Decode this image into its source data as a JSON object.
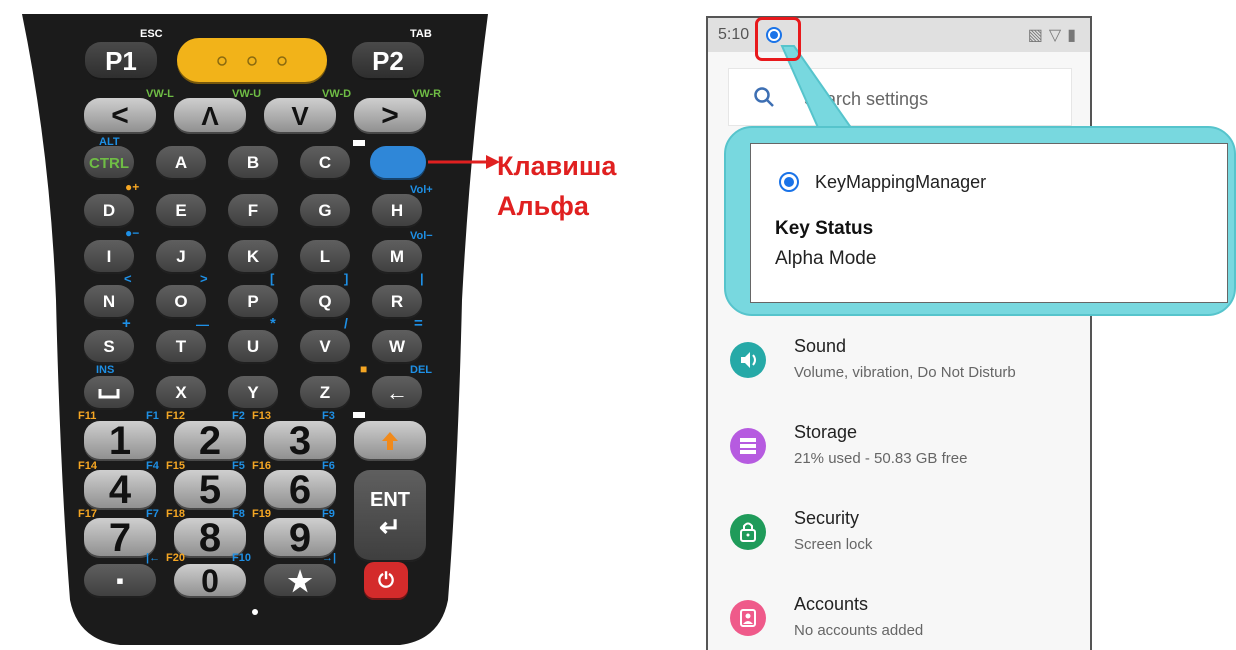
{
  "keypad": {
    "function_labels": {
      "esc": "ESC",
      "tab": "TAB",
      "alt": "ALT",
      "ins": "INS",
      "del": "DEL"
    },
    "top_keys": {
      "p1": "P1",
      "p2": "P2"
    },
    "nav_labels": {
      "vw_l": "VW-L",
      "vw_u": "VW-U",
      "vw_d": "VW-D",
      "vw_r": "VW-R"
    },
    "nav_keys": {
      "left": "<",
      "up": "Λ",
      "down": "V",
      "right": ">"
    },
    "volume_labels": {
      "up": "Vol+",
      "down": "Vol−"
    },
    "letter_keys": [
      "CTRL",
      "A",
      "B",
      "C",
      "D",
      "E",
      "F",
      "G",
      "H",
      "I",
      "J",
      "K",
      "L",
      "M",
      "N",
      "O",
      "P",
      "Q",
      "R",
      "S",
      "T",
      "U",
      "V",
      "W",
      "X",
      "Y",
      "Z"
    ],
    "symbol_labels": {
      "lt": "<",
      "gt": ">",
      "lbrack": "[",
      "rbrack": "]",
      "pipe": "|",
      "plus": "+",
      "minus": "—",
      "star": "*",
      "slash": "/",
      "equals": "="
    },
    "fkey_labels": [
      "F11",
      "F1",
      "F12",
      "F2",
      "F13",
      "F3",
      "F14",
      "F4",
      "F15",
      "F5",
      "F16",
      "F6",
      "F17",
      "F7",
      "F18",
      "F8",
      "F19",
      "F9",
      "F20",
      "F10"
    ],
    "number_keys": [
      "1",
      "2",
      "3",
      "4",
      "5",
      "6",
      "7",
      "8",
      "9",
      "0"
    ],
    "ent_label": "ENT",
    "dot_key": "▪",
    "star_key": "★",
    "alpha_key_caption_1": "Клавиша",
    "alpha_key_caption_2": "Альфа",
    "colors": {
      "body": "#1b1b1b",
      "scanner": "#f2b319",
      "alpha_key": "#2f87d8",
      "power": "#d42b2b",
      "arrow": "#e02020"
    }
  },
  "phone": {
    "status": {
      "time": "5:10",
      "icons": [
        "vibrate-icon",
        "wifi-icon",
        "battery-icon"
      ]
    },
    "search": {
      "placeholder": "Search settings"
    },
    "notification": {
      "app_name": "KeyMappingManager",
      "title": "Key Status",
      "body": "Alpha Mode"
    },
    "settings": [
      {
        "title": "Sound",
        "subtitle": "Volume, vibration, Do Not Disturb",
        "icon": "volume-icon",
        "color": "#26a9a7"
      },
      {
        "title": "Storage",
        "subtitle": "21% used - 50.83 GB free",
        "icon": "storage-icon",
        "color": "#b65be0"
      },
      {
        "title": "Security",
        "subtitle": "Screen lock",
        "icon": "lock-icon",
        "color": "#1f9b5a"
      },
      {
        "title": "Accounts",
        "subtitle": "No accounts added",
        "icon": "account-icon",
        "color": "#ef5a8a"
      }
    ]
  }
}
